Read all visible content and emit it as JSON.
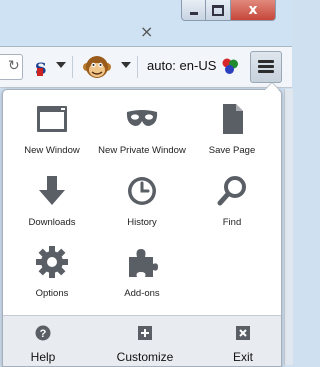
{
  "window": {
    "tab_close": "×",
    "close_glyph": "x"
  },
  "toolbar": {
    "language_label": "auto: en-US"
  },
  "menu": {
    "items": [
      {
        "label": "New Window",
        "icon": "new-window-icon"
      },
      {
        "label": "New Private Window",
        "icon": "mask-icon"
      },
      {
        "label": "Save Page",
        "icon": "page-icon"
      },
      {
        "label": "Downloads",
        "icon": "download-arrow-icon"
      },
      {
        "label": "History",
        "icon": "clock-icon"
      },
      {
        "label": "Find",
        "icon": "magnifier-icon"
      },
      {
        "label": "Options",
        "icon": "gear-icon"
      },
      {
        "label": "Add-ons",
        "icon": "puzzle-icon"
      }
    ],
    "footer": {
      "help": "Help",
      "customize": "Customize",
      "exit": "Exit"
    }
  },
  "colors": {
    "icon": "#5a5f66",
    "close_button": "#c6463a",
    "footer_bg": "#e8ecf1"
  }
}
